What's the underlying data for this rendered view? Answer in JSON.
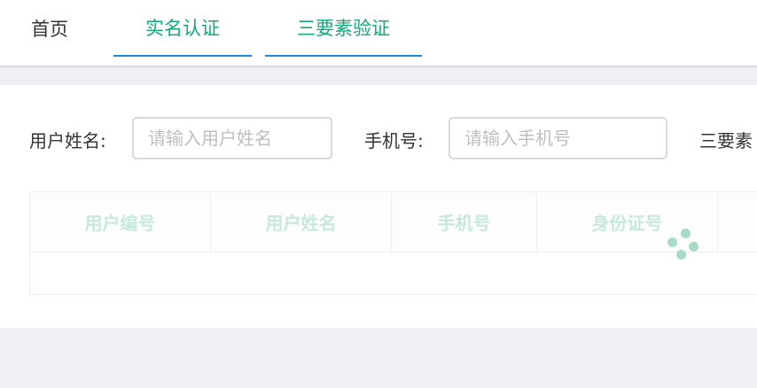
{
  "tabs": [
    {
      "label": "首页",
      "active": false
    },
    {
      "label": "实名认证",
      "active": true
    },
    {
      "label": "三要素验证",
      "active": true
    }
  ],
  "form": {
    "username_label": "用户姓名:",
    "username_placeholder": "请输入用户姓名",
    "phone_label": "手机号:",
    "phone_placeholder": "请输入手机号",
    "third_label": "三要素"
  },
  "table": {
    "columns": [
      "用户编号",
      "用户姓名",
      "手机号",
      "身份证号"
    ]
  },
  "colors": {
    "accent_green": "#13a97a",
    "tab_underline": "#1e88e5",
    "loading": "#a6dcc6"
  }
}
